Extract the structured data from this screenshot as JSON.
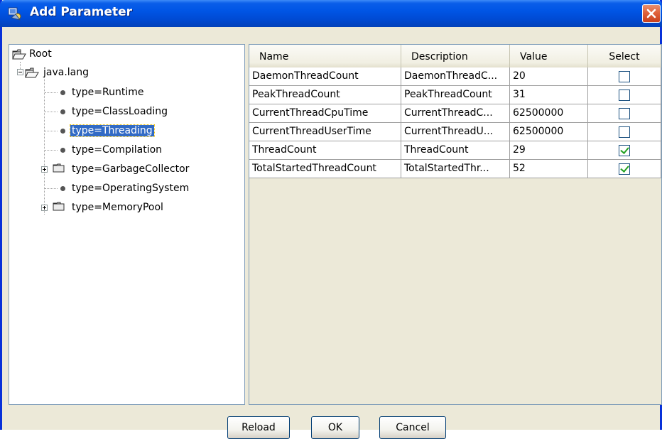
{
  "window": {
    "title": "Add Parameter"
  },
  "tree": {
    "root": "Root",
    "java_lang": "java.lang",
    "items": [
      {
        "label": "type=Runtime",
        "kind": "leaf"
      },
      {
        "label": "type=ClassLoading",
        "kind": "leaf"
      },
      {
        "label": "type=Threading",
        "kind": "leaf",
        "selected": true
      },
      {
        "label": "type=Compilation",
        "kind": "leaf"
      },
      {
        "label": "type=GarbageCollector",
        "kind": "folder"
      },
      {
        "label": "type=OperatingSystem",
        "kind": "leaf"
      },
      {
        "label": "type=MemoryPool",
        "kind": "folder"
      }
    ]
  },
  "table": {
    "headers": {
      "name": "Name",
      "description": "Description",
      "value": "Value",
      "select": "Select"
    },
    "rows": [
      {
        "name": "DaemonThreadCount",
        "description": "DaemonThreadC...",
        "value": "20",
        "selected": false
      },
      {
        "name": "PeakThreadCount",
        "description": "PeakThreadCount",
        "value": "31",
        "selected": false
      },
      {
        "name": "CurrentThreadCpuTime",
        "description": "CurrentThreadC...",
        "value": "62500000",
        "selected": false
      },
      {
        "name": "CurrentThreadUserTime",
        "description": "CurrentThreadU...",
        "value": "62500000",
        "selected": false
      },
      {
        "name": "ThreadCount",
        "description": "ThreadCount",
        "value": "29",
        "selected": true
      },
      {
        "name": "TotalStartedThreadCount",
        "description": "TotalStartedThr...",
        "value": "52",
        "selected": true
      }
    ]
  },
  "buttons": {
    "reload": "Reload",
    "ok": "OK",
    "cancel": "Cancel"
  },
  "colors": {
    "titlebar": "#0055e5",
    "selection": "#316ac5",
    "close": "#e0633c",
    "check": "#21a121"
  }
}
